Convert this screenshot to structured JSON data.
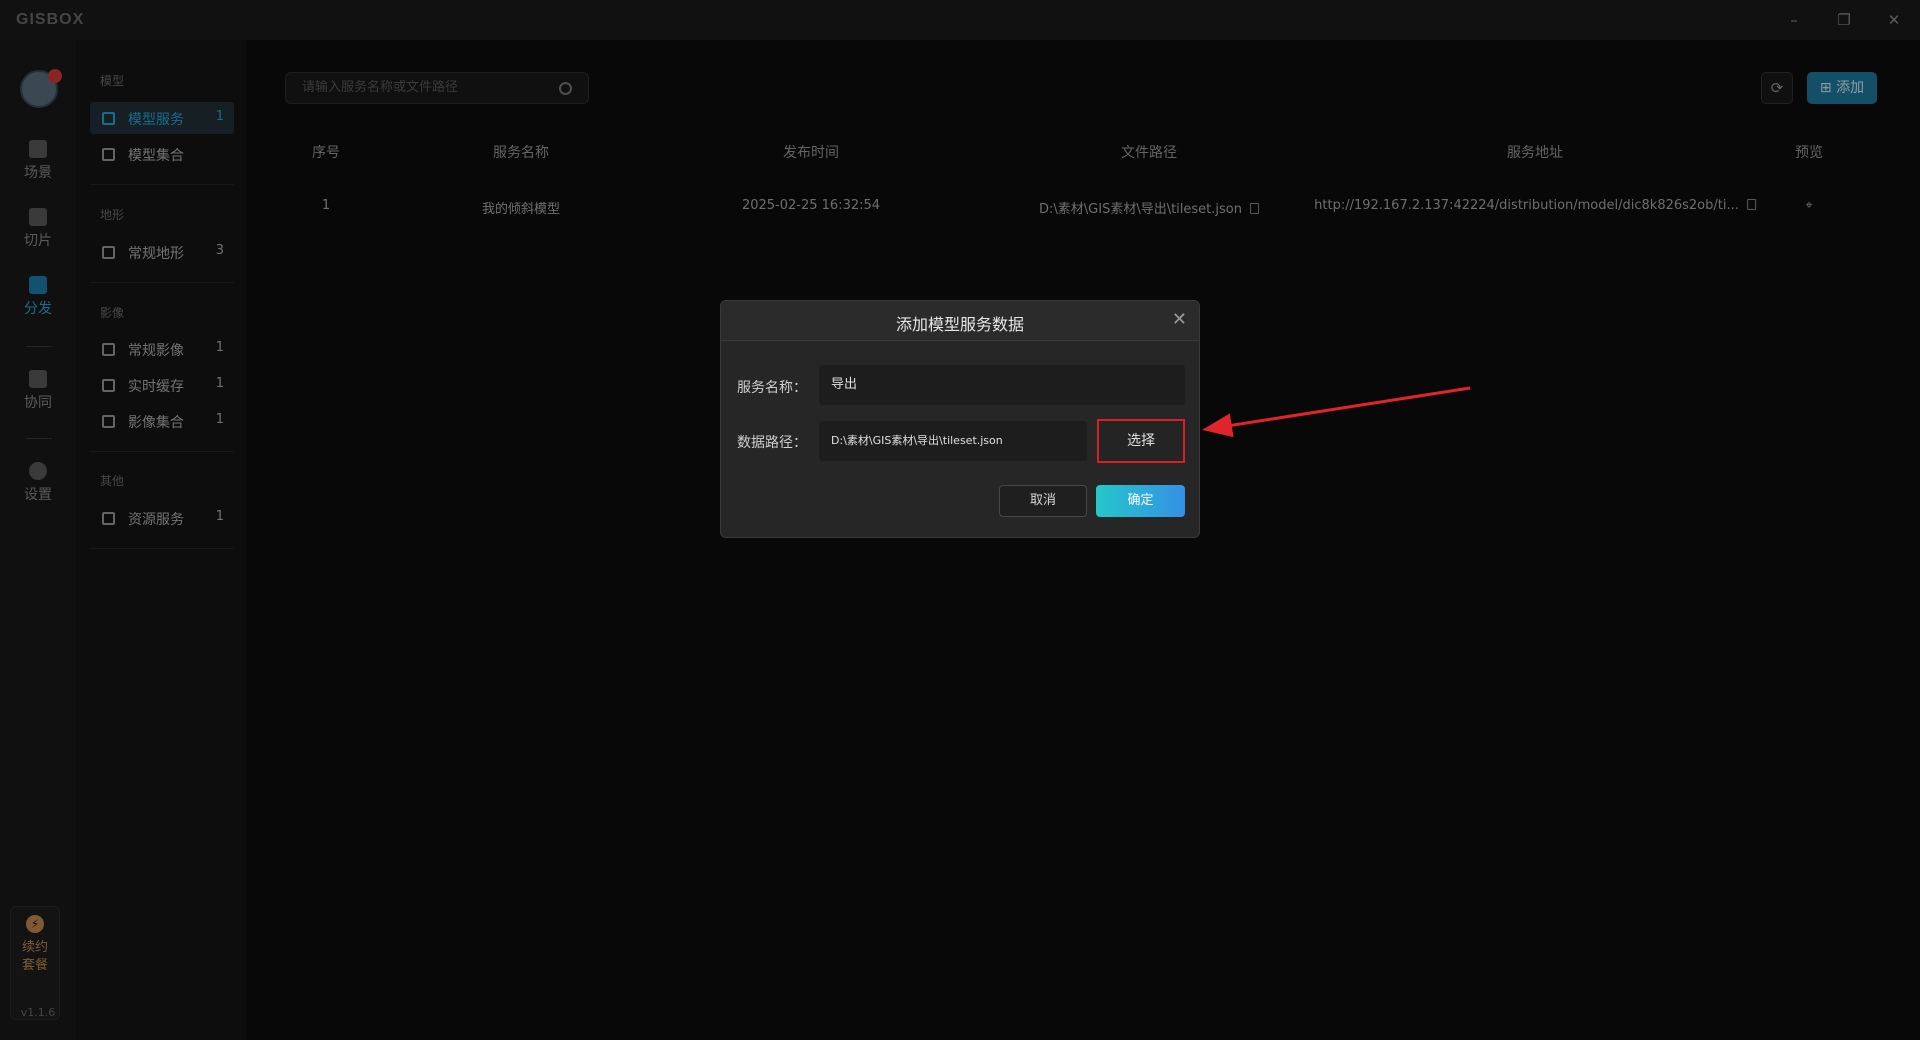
{
  "app": {
    "logo": "GISBOX",
    "version": "v1.1.6"
  },
  "window_controls": {
    "minimize": "–",
    "restore": "❐",
    "close": "✕"
  },
  "rail": {
    "items": [
      {
        "label": "场景",
        "icon": "home-icon"
      },
      {
        "label": "切片",
        "icon": "edit-icon"
      },
      {
        "label": "分发",
        "icon": "share-icon",
        "active": true
      },
      {
        "label": "协同",
        "icon": "lock-icon"
      },
      {
        "label": "设置",
        "icon": "gear-icon"
      }
    ],
    "renew": {
      "line1": "续约",
      "line2": "套餐"
    }
  },
  "categories": {
    "model": {
      "header": "模型",
      "items": [
        {
          "label": "模型服务",
          "count": "1"
        },
        {
          "label": "模型集合",
          "count": ""
        }
      ]
    },
    "terrain": {
      "header": "地形",
      "items": [
        {
          "label": "常规地形",
          "count": "3"
        }
      ]
    },
    "imagery": {
      "header": "影像",
      "items": [
        {
          "label": "常规影像",
          "count": "1"
        },
        {
          "label": "实时缓存",
          "count": "1"
        },
        {
          "label": "影像集合",
          "count": "1"
        }
      ]
    },
    "other": {
      "header": "其他",
      "items": [
        {
          "label": "资源服务",
          "count": "1"
        }
      ]
    }
  },
  "toolbar": {
    "search_placeholder": "请输入服务名称或文件路径",
    "add_label": "添加"
  },
  "table": {
    "headers": [
      "序号",
      "服务名称",
      "发布时间",
      "文件路径",
      "服务地址",
      "预览"
    ],
    "rows": [
      [
        "1",
        "我的倾斜模型",
        "2025-02-25 16:32:54",
        "D:\\素材\\GIS素材\\导出\\tileset.json",
        "http://192.167.2.137:42224/distribution/model/dic8k826s2ob/ti..."
      ]
    ]
  },
  "modal": {
    "title": "添加模型服务数据",
    "name_label": "服务名称：",
    "name_value": "导出",
    "path_label": "数据路径：",
    "path_value": "D:\\素材\\GIS素材\\导出\\tileset.json",
    "choose_label": "选择",
    "cancel_label": "取消",
    "confirm_label": "确定"
  },
  "annotation": {
    "highlight_color": "#d62027",
    "arrow_color": "#e0242b"
  }
}
